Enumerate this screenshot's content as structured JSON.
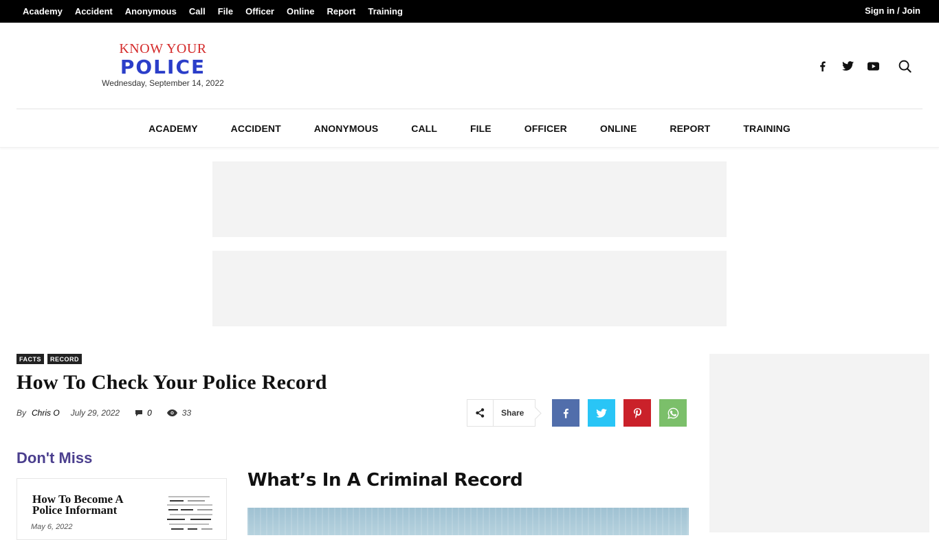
{
  "topbar": {
    "menu": [
      "Academy",
      "Accident",
      "Anonymous",
      "Call",
      "File",
      "Officer",
      "Online",
      "Report",
      "Training"
    ],
    "signin_label": "Sign in / Join"
  },
  "logo": {
    "top_text": "KNOW YOUR",
    "main_text": "POLICE",
    "date": "Wednesday, September 14, 2022"
  },
  "main_nav": [
    "ACADEMY",
    "ACCIDENT",
    "ANONYMOUS",
    "CALL",
    "FILE",
    "OFFICER",
    "ONLINE",
    "REPORT",
    "TRAINING"
  ],
  "article": {
    "tags": [
      "FACTS",
      "RECORD"
    ],
    "title": "How To Check Your Police Record",
    "by_label": "By",
    "author": "Chris O",
    "date": "July 29, 2022",
    "comments": "0",
    "views": "33",
    "share_label": "Share",
    "section_heading": "What’s In A Criminal Record"
  },
  "share_buttons": [
    {
      "name": "facebook",
      "color": "#516eab"
    },
    {
      "name": "twitter",
      "color": "#29c5f6"
    },
    {
      "name": "pinterest",
      "color": "#ca212a"
    },
    {
      "name": "whatsapp",
      "color": "#7bbf6a"
    }
  ],
  "dont_miss": {
    "heading": "Don't Miss",
    "card": {
      "title": "How To Become A Police Informant",
      "date": "May 6, 2022"
    }
  },
  "colors": {
    "brand_red": "#d42a2a",
    "brand_blue": "#2b3ec9",
    "dont_miss_purple": "#4b3f8e"
  }
}
